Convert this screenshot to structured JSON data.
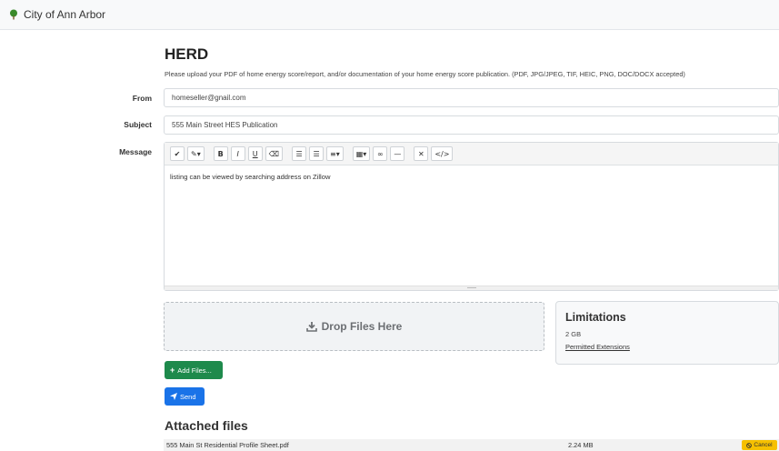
{
  "navbar": {
    "brand": "City of Ann Arbor"
  },
  "form": {
    "title": "HERD",
    "instructions": "Please upload your PDF of home energy score/report, and/or documentation of your home energy score publication. (PDF, JPG/JPEG, TIF, HEIC, PNG, DOC/DOCX accepted)",
    "from_label": "From",
    "from_value": "homeseller@gnail.com",
    "subject_label": "Subject",
    "subject_value": "555 Main Street HES Publication",
    "message_label": "Message",
    "message_value": "listing can be viewed by searching address on Zillow"
  },
  "toolbar": {
    "buttons": [
      {
        "icon": "pencil-icon",
        "glyph": "✔"
      },
      {
        "icon": "magic-wand-icon",
        "glyph": "✎▾"
      },
      {
        "icon": "bold-icon",
        "glyph": "B"
      },
      {
        "icon": "italic-icon",
        "glyph": "I"
      },
      {
        "icon": "underline-icon",
        "glyph": "U"
      },
      {
        "icon": "eraser-icon",
        "glyph": "⌫"
      },
      {
        "icon": "unordered-list-icon",
        "glyph": "☰"
      },
      {
        "icon": "ordered-list-icon",
        "glyph": "☰"
      },
      {
        "icon": "align-icon",
        "glyph": "≡▾"
      },
      {
        "icon": "table-icon",
        "glyph": "▦▾"
      },
      {
        "icon": "link-icon",
        "glyph": "∞"
      },
      {
        "icon": "horizontal-rule-icon",
        "glyph": "—"
      },
      {
        "icon": "fullscreen-icon",
        "glyph": "✕"
      },
      {
        "icon": "code-view-icon",
        "glyph": "</>"
      }
    ]
  },
  "upload": {
    "drop_label": "Drop Files Here",
    "add_button": "Add Files...",
    "send_button": "Send"
  },
  "limitations": {
    "title": "Limitations",
    "size": "2 GB",
    "link": "Permitted Extensions"
  },
  "attached": {
    "title": "Attached files",
    "files": [
      {
        "name": "555 Main St Residential Profile Sheet.pdf",
        "size": "2.24 MB",
        "action": "Cancel"
      }
    ]
  },
  "colors": {
    "brand_tree": "#3a8a2a",
    "add_button": "#1e8a4c",
    "send_button": "#1a73e8",
    "cancel_button": "#f6c000"
  }
}
